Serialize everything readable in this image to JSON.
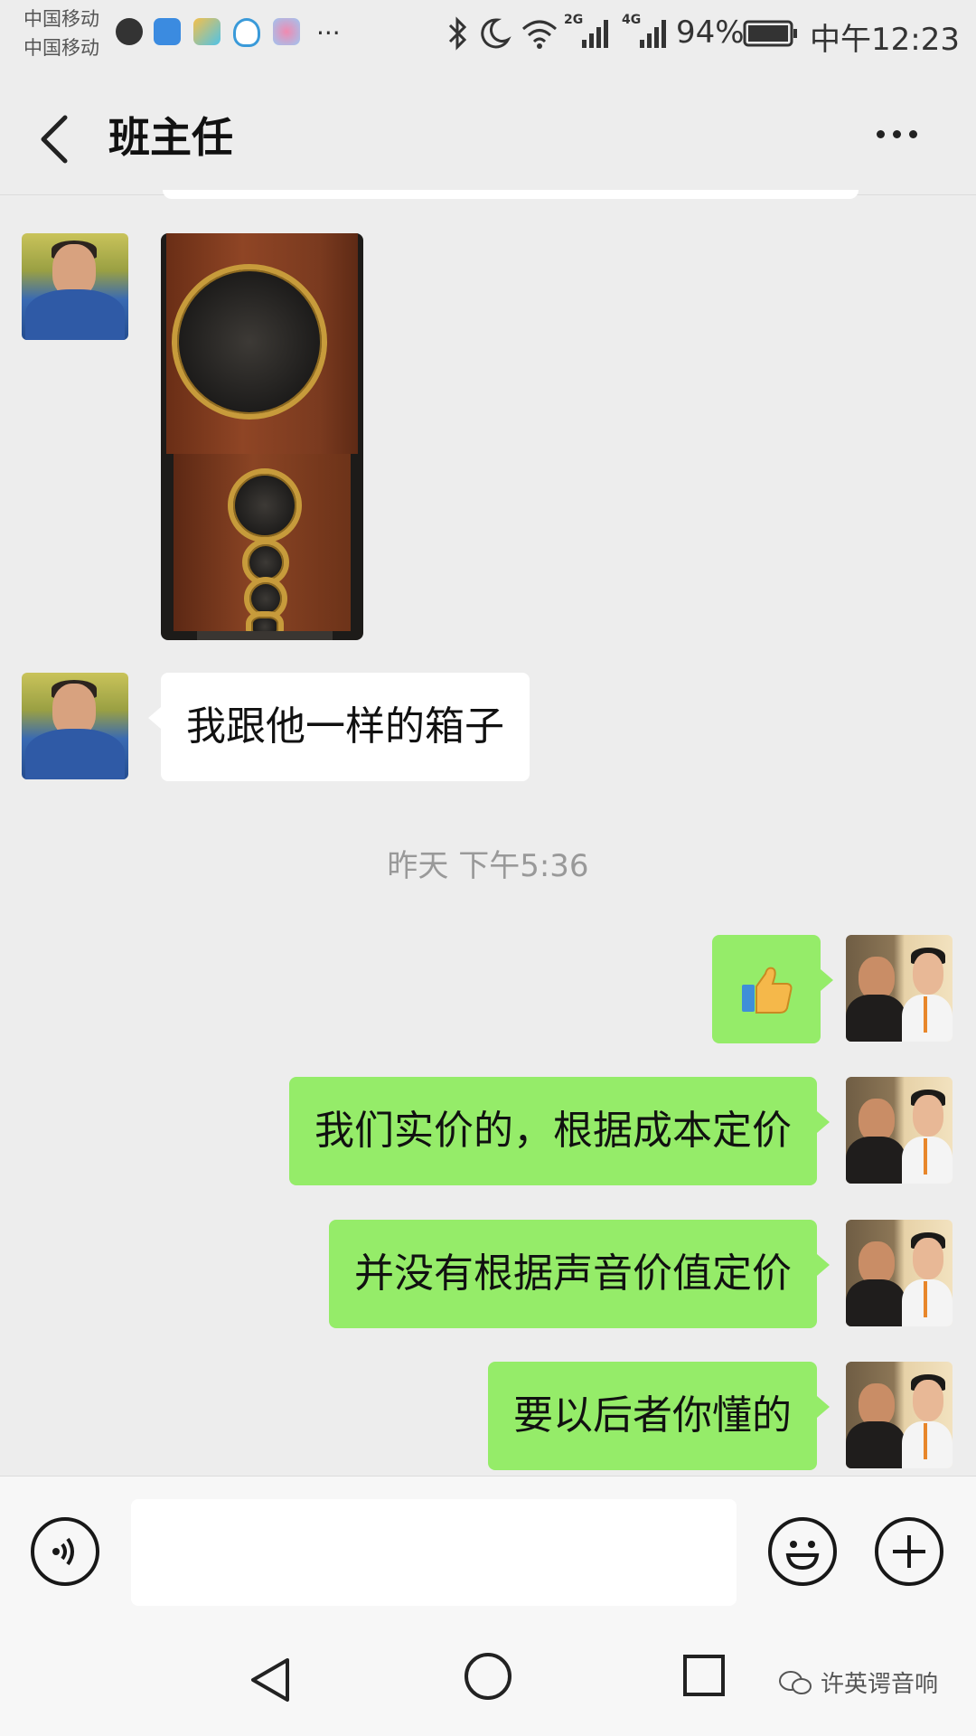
{
  "status_bar": {
    "carrier_1": "中国移动",
    "carrier_2": "中国移动",
    "more_glyph": "···",
    "network_2g": "2G",
    "network_4g": "4G",
    "battery": "94%",
    "time": "中午12:23",
    "icons": [
      "taobao-icon",
      "shield-app-icon",
      "photo-app-icon",
      "qq-icon",
      "flower-app-icon",
      "bluetooth-icon",
      "moon-icon",
      "wifi-icon",
      "signal-icon",
      "battery-icon"
    ]
  },
  "header": {
    "title": "班主任"
  },
  "messages": [
    {
      "side": "left",
      "type": "image",
      "content": "speaker"
    },
    {
      "side": "left",
      "type": "text",
      "text": "我跟他一样的箱子"
    },
    {
      "type": "timestamp",
      "text": "昨天 下午5:36"
    },
    {
      "side": "right",
      "type": "emoji",
      "content": "thumbs-up"
    },
    {
      "side": "right",
      "type": "text",
      "text": "我们实价的，根据成本定价"
    },
    {
      "side": "right",
      "type": "text",
      "text": "并没有根据声音价值定价"
    },
    {
      "side": "right",
      "type": "text",
      "text": "要以后者你懂的"
    }
  ],
  "input_bar": {
    "placeholder": ""
  },
  "watermark": {
    "text": "许英谔音响"
  },
  "colors": {
    "background": "#ededed",
    "sent_bubble": "#95ec69",
    "received_bubble": "#ffffff"
  }
}
